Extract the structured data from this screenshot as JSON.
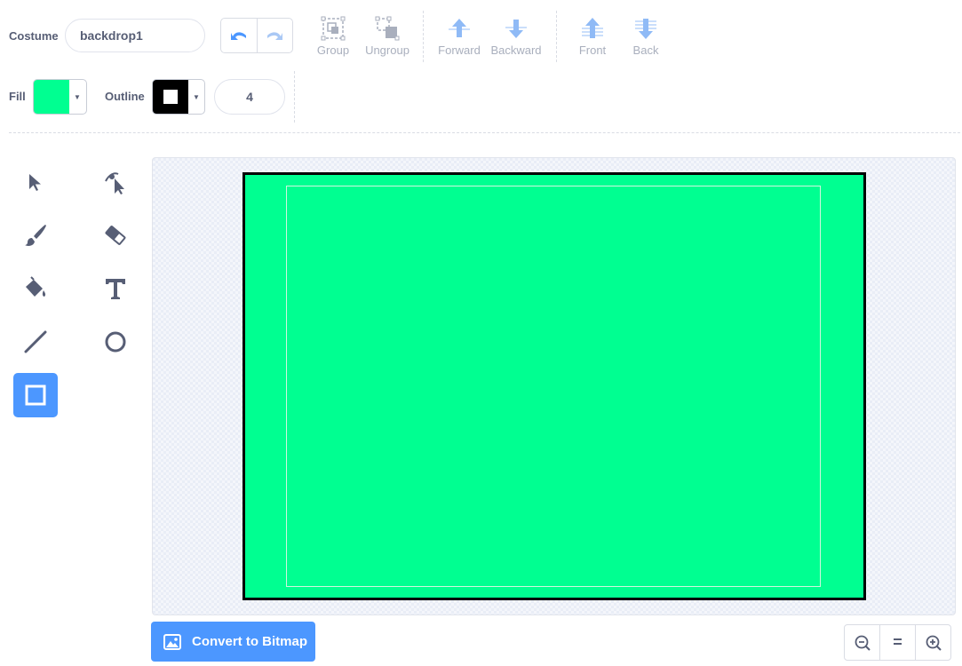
{
  "costume": {
    "label": "Costume",
    "name": "backdrop1"
  },
  "toolbar": {
    "group": "Group",
    "ungroup": "Ungroup",
    "forward": "Forward",
    "backward": "Backward",
    "front": "Front",
    "back": "Back"
  },
  "style": {
    "fill_label": "Fill",
    "fill_color": "#00ff91",
    "outline_label": "Outline",
    "outline_color": "#000000",
    "outline_width": "4"
  },
  "tools": {
    "items": [
      "select",
      "reshape",
      "brush",
      "eraser",
      "fill",
      "text",
      "line",
      "circle",
      "rectangle"
    ],
    "active": "rectangle"
  },
  "canvas": {
    "shape_color": "#00ff91",
    "stroke_color": "#000000"
  },
  "bottom": {
    "convert_label": "Convert to Bitmap",
    "zoom_reset_label": "="
  },
  "colors": {
    "accent": "#4c97ff",
    "text": "#575e75",
    "disabled": "#a9afbd"
  }
}
